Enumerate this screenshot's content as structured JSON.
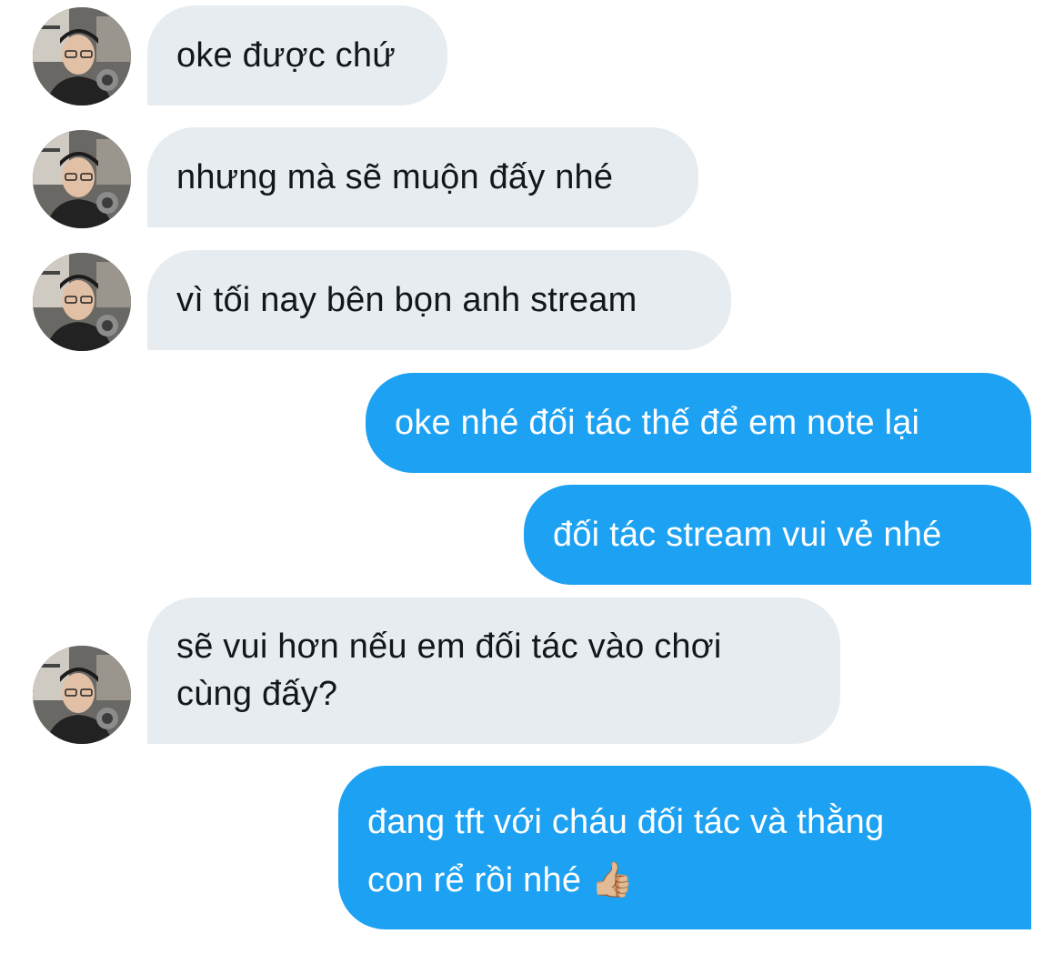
{
  "conversation": {
    "messages": [
      {
        "sender": "them",
        "text": "oke được chứ"
      },
      {
        "sender": "them",
        "text": "nhưng mà sẽ muộn đấy nhé"
      },
      {
        "sender": "them",
        "text": "vì tối nay bên bọn anh stream"
      },
      {
        "sender": "me",
        "text": "oke nhé đối tác thế để em note lại"
      },
      {
        "sender": "me",
        "text": "đối tác stream vui vẻ nhé"
      },
      {
        "sender": "them",
        "lines": [
          "sẽ vui hơn nếu em đối tác vào chơi",
          "cùng đấy?"
        ]
      },
      {
        "sender": "me",
        "lines": [
          "đang tft với cháu đối tác và thằng",
          "con rể rồi nhé 👍🏼"
        ]
      }
    ]
  },
  "colors": {
    "incoming_bubble": "#e6ecf0",
    "outgoing_bubble": "#1da1f2",
    "incoming_text": "#14171a",
    "outgoing_text": "#ffffff"
  },
  "icons": {
    "avatar": "avatar-photo-icon",
    "thumbs_up": "thumbs-up-emoji"
  }
}
